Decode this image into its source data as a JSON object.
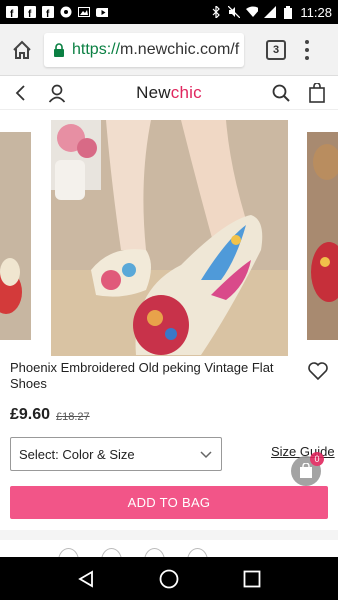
{
  "status_bar": {
    "time": "11:28",
    "left_icons": [
      "facebook-icon",
      "facebook-icon",
      "facebook-icon",
      "chrome-notification-icon",
      "image-icon",
      "youtube-icon"
    ],
    "right_icons": [
      "bluetooth-icon",
      "mute-icon",
      "wifi-icon",
      "signal-icon",
      "battery-icon"
    ]
  },
  "browser": {
    "url_scheme": "https://",
    "url_rest": "m.newchic.com/f",
    "tab_count": "3"
  },
  "site_header": {
    "logo_part1": "New",
    "logo_part2": "chic"
  },
  "product": {
    "name": "Phoenix Embroidered Old peking Vintage Flat Shoes",
    "price": "£9.60",
    "old_price": "£18.27",
    "select_label": "Select: Color & Size",
    "size_guide": "Size Guide",
    "bag_count": "0",
    "add_to_bag": "ADD TO BAG"
  },
  "colors": {
    "brand": "#e0265e",
    "button": "#f25588",
    "secure": "#0b8043"
  }
}
